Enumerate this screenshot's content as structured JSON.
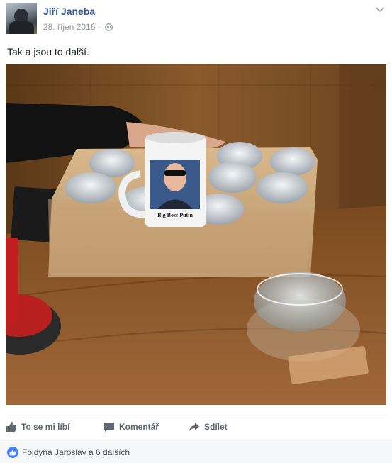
{
  "post": {
    "author": "Jiří Janeba",
    "date": "28. říjen 2016",
    "separator": "·",
    "text": "Tak a jsou to další.",
    "photo": {
      "mug_caption": "Big Boss Putin"
    }
  },
  "actions": {
    "like": "To se mi líbí",
    "comment": "Komentář",
    "share": "Sdílet"
  },
  "reactions": {
    "summary": "Foldyna Jaroslav a 6 dalších"
  },
  "colors": {
    "link": "#365899",
    "muted": "#90949c",
    "action": "#606770",
    "like_blue": "#4080ff"
  },
  "icons": {
    "audience": "globe-icon",
    "menu": "chevron-down-icon",
    "like": "thumbs-up-icon",
    "comment": "speech-bubble-icon",
    "share": "share-arrow-icon"
  }
}
